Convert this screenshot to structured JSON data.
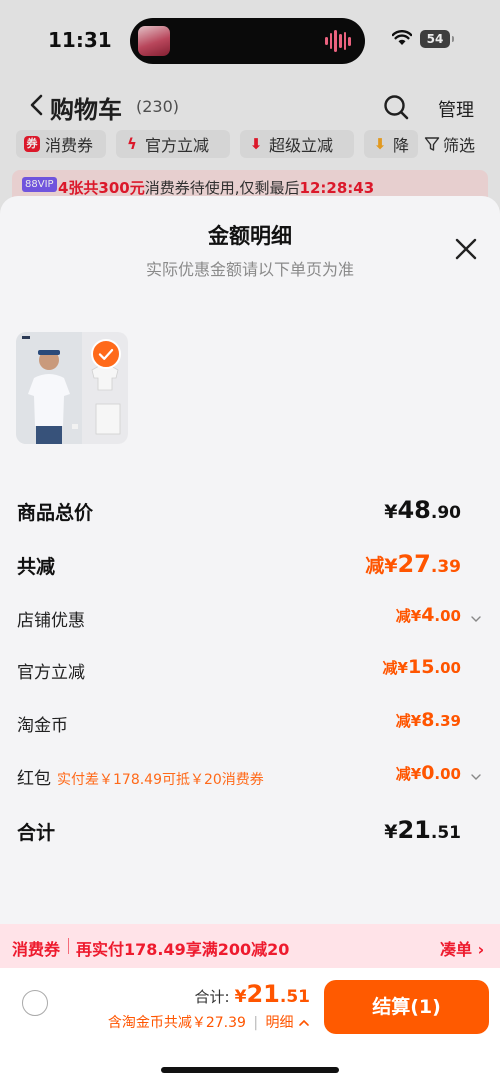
{
  "status_bar": {
    "time": "11:31",
    "battery": "54"
  },
  "header": {
    "title": "购物车",
    "count": "(230)",
    "manage": "管理"
  },
  "filters": {
    "chips": [
      "消费券",
      "官方立减",
      "超级立减",
      "降"
    ],
    "filter_label": "筛选"
  },
  "promo_banner": {
    "vip": "88VIP",
    "highlight": "4张共300元",
    "text": "消费券待使用,仅剩最后",
    "countdown": "12:28:43"
  },
  "sheet": {
    "title": "金额明细",
    "subtitle": "实际优惠金额请以下单页为准",
    "rows": {
      "goods_total": {
        "label": "商品总价",
        "prefix": "¥",
        "int": "48",
        "dec": ".90"
      },
      "total_reduction": {
        "label": "共减",
        "prefix": "减¥",
        "int": "27",
        "dec": ".39"
      },
      "shop_discount": {
        "label": "店铺优惠",
        "prefix": "减¥",
        "int": "4",
        "dec": ".00"
      },
      "official_discount": {
        "label": "官方立减",
        "prefix": "减¥",
        "int": "15",
        "dec": ".00"
      },
      "taobao_coin": {
        "label": "淘金币",
        "prefix": "减¥",
        "int": "8",
        "dec": ".39"
      },
      "red_packet": {
        "label": "红包",
        "hint": "实付差￥178.49可抵￥20消费券",
        "prefix": "减¥",
        "int": "0",
        "dec": ".00"
      },
      "grand_total": {
        "label": "合计",
        "prefix": "¥",
        "int": "21",
        "dec": ".51"
      }
    }
  },
  "coupon_bar": {
    "tag": "消费券",
    "text": "再实付178.49享满200减20",
    "link": "凑单 ›"
  },
  "checkout": {
    "total_label": "合计:",
    "total_prefix": "¥",
    "total_int": "21",
    "total_dec": ".51",
    "discount_text": "含淘金币共减￥27.39",
    "separator": "|",
    "detail_label": "明细",
    "pay_label": "结算(1)"
  },
  "colors": {
    "accent": "#ff5a00",
    "price": "#ff5500",
    "coupon": "#ee1b2e"
  }
}
